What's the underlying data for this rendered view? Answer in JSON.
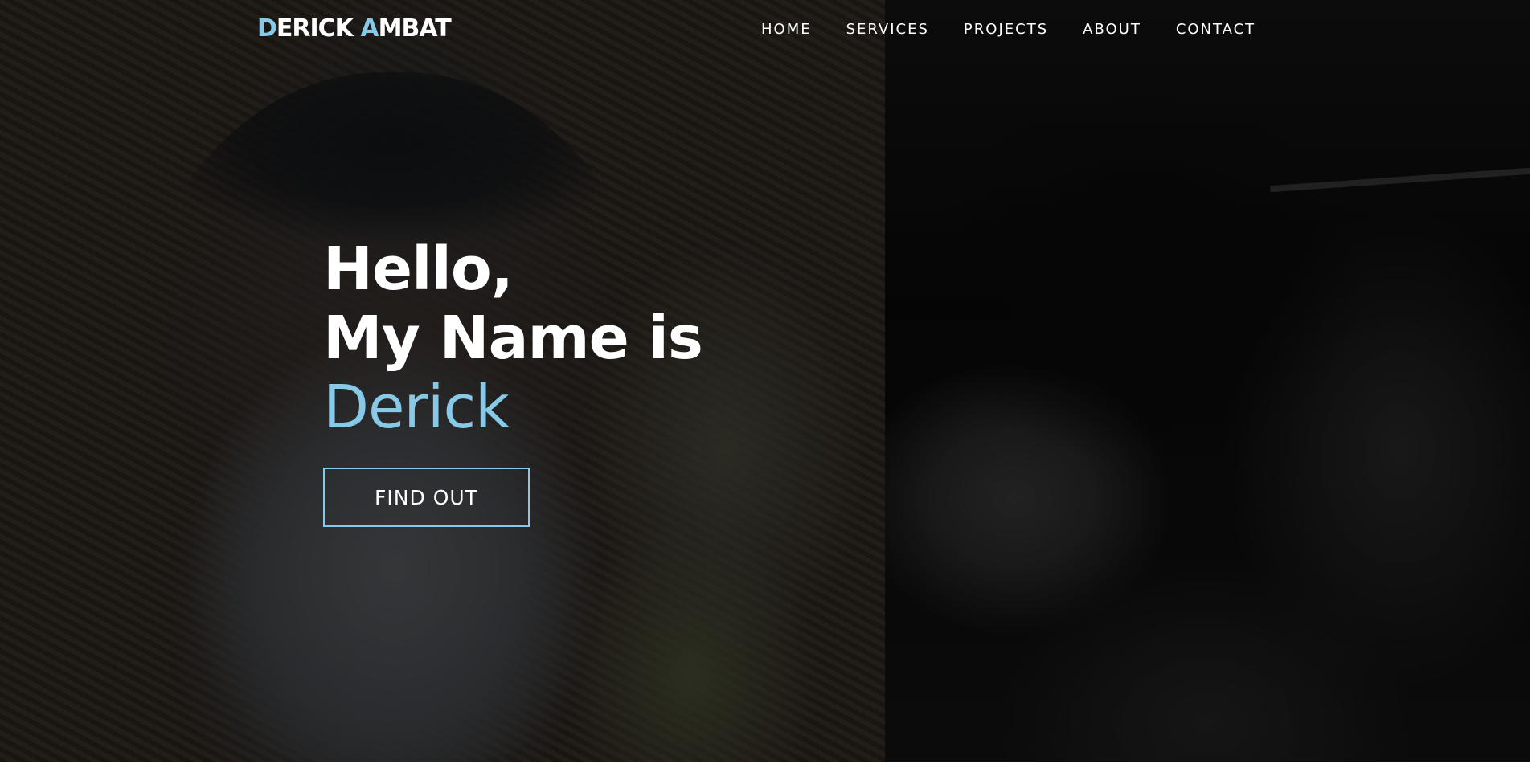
{
  "brand": {
    "first_initial": "D",
    "first_rest": "ERICK ",
    "last_initial": "A",
    "last_rest": "MBAT"
  },
  "nav": {
    "items": [
      {
        "label": "HOME"
      },
      {
        "label": "SERVICES"
      },
      {
        "label": "PROJECTS"
      },
      {
        "label": "ABOUT"
      },
      {
        "label": "CONTACT"
      }
    ]
  },
  "hero": {
    "line1": "Hello,",
    "line2": "My Name is",
    "name": "Derick",
    "cta_label": "FIND OUT"
  },
  "colors": {
    "accent": "#87c9e6",
    "text": "#ffffff",
    "overlay": "rgba(0,0,0,0.42)"
  }
}
